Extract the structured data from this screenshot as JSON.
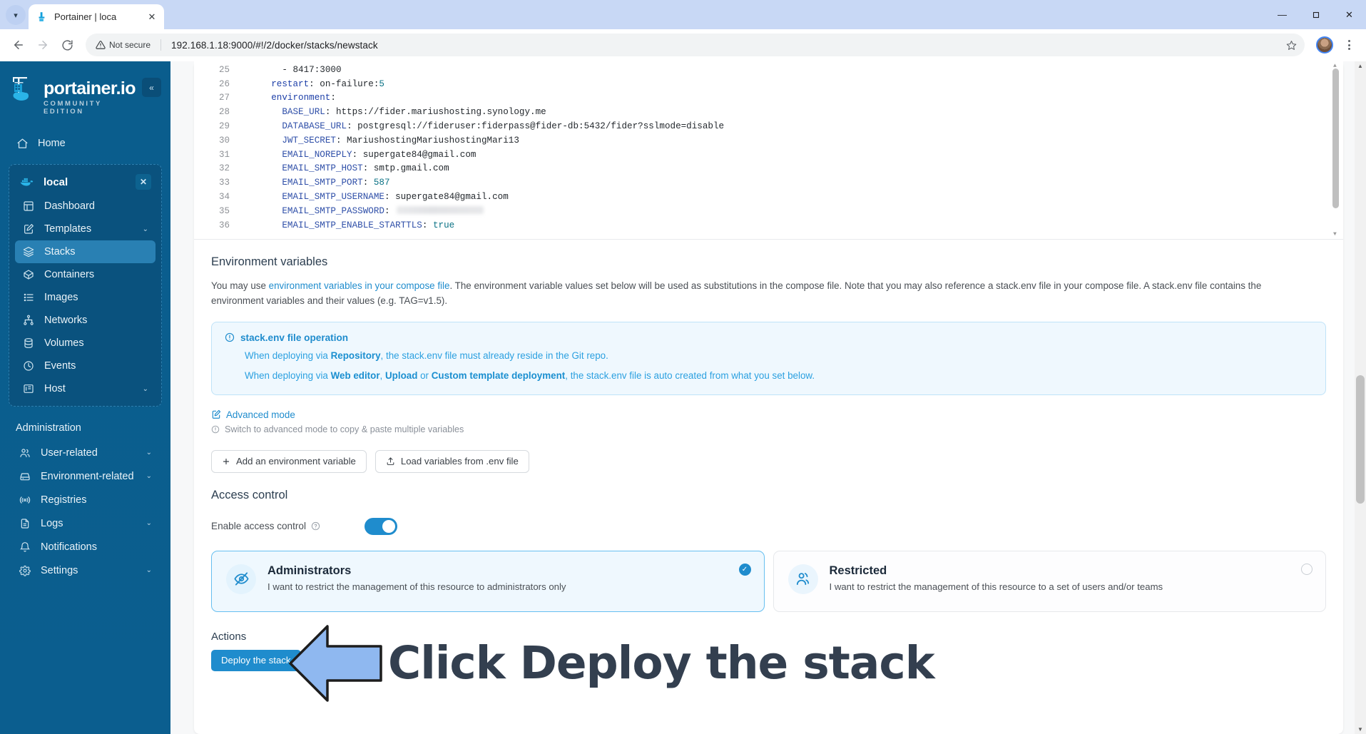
{
  "browser": {
    "tab": {
      "title": "Portainer | loca",
      "favicon_icon": "portainer-favicon",
      "close_icon": "close-icon"
    },
    "tab_list_icon": "chevron-down-icon",
    "window": {
      "minimize": "minimize-icon",
      "maximize": "maximize-icon",
      "close": "close-icon"
    },
    "nav": {
      "back": "back-arrow-icon",
      "forward": "forward-arrow-icon",
      "reload": "reload-icon"
    },
    "omnibox": {
      "security_label": "Not secure",
      "security_icon": "warning-triangle-icon",
      "url": "192.168.1.18:9000/#!/2/docker/stacks/newstack",
      "bookmark_icon": "star-icon"
    },
    "profile_icon": "avatar",
    "menu_icon": "kebab-menu-icon"
  },
  "sidebar": {
    "brand": {
      "name": "portainer.io",
      "edition": "COMMUNITY EDITION",
      "logo_icon": "portainer-logo-icon"
    },
    "collapse_icon": "double-chevron-left-icon",
    "home": {
      "label": "Home",
      "icon": "home-icon"
    },
    "environment": {
      "name": "local",
      "icon": "docker-whale-icon",
      "close_icon": "close-icon",
      "items": [
        {
          "label": "Dashboard",
          "icon": "dashboard-icon",
          "chevron": "",
          "active": false
        },
        {
          "label": "Templates",
          "icon": "template-edit-icon",
          "chevron": "chevron-down-icon",
          "active": false
        },
        {
          "label": "Stacks",
          "icon": "stacks-layers-icon",
          "chevron": "",
          "active": true
        },
        {
          "label": "Containers",
          "icon": "container-box-icon",
          "chevron": "",
          "active": false
        },
        {
          "label": "Images",
          "icon": "images-list-icon",
          "chevron": "",
          "active": false
        },
        {
          "label": "Networks",
          "icon": "network-nodes-icon",
          "chevron": "",
          "active": false
        },
        {
          "label": "Volumes",
          "icon": "volumes-database-icon",
          "chevron": "",
          "active": false
        },
        {
          "label": "Events",
          "icon": "clock-icon",
          "chevron": "",
          "active": false
        },
        {
          "label": "Host",
          "icon": "host-server-icon",
          "chevron": "chevron-down-icon",
          "active": false
        }
      ]
    },
    "administration_label": "Administration",
    "admin_items": [
      {
        "label": "User-related",
        "icon": "users-icon",
        "chevron": "chevron-down-icon"
      },
      {
        "label": "Environment-related",
        "icon": "environment-box-icon",
        "chevron": "chevron-down-icon"
      },
      {
        "label": "Registries",
        "icon": "registry-broadcast-icon",
        "chevron": ""
      },
      {
        "label": "Logs",
        "icon": "document-lines-icon",
        "chevron": "chevron-down-icon"
      },
      {
        "label": "Notifications",
        "icon": "bell-icon",
        "chevron": ""
      },
      {
        "label": "Settings",
        "icon": "gear-icon",
        "chevron": "chevron-down-icon"
      }
    ]
  },
  "editor": {
    "lines": [
      {
        "no": "25",
        "indent": 6,
        "segments": [
          {
            "t": "- ",
            "c": "k-str"
          },
          {
            "t": "8417:3000",
            "c": "k-str"
          }
        ]
      },
      {
        "no": "26",
        "indent": 4,
        "segments": [
          {
            "t": "restart",
            "c": "k-key"
          },
          {
            "t": ": on-failure:",
            "c": "k-str"
          },
          {
            "t": "5",
            "c": "k-num"
          }
        ]
      },
      {
        "no": "27",
        "indent": 4,
        "segments": [
          {
            "t": "environment",
            "c": "k-key"
          },
          {
            "t": ":",
            "c": "k-str"
          }
        ]
      },
      {
        "no": "28",
        "indent": 6,
        "segments": [
          {
            "t": "BASE_URL",
            "c": "k-prop"
          },
          {
            "t": ": https://fider.mariushosting.synology.me",
            "c": "k-str"
          }
        ]
      },
      {
        "no": "29",
        "indent": 6,
        "segments": [
          {
            "t": "DATABASE_URL",
            "c": "k-prop"
          },
          {
            "t": ": postgresql://fideruser:fiderpass@fider-db:5432/fider?sslmode=disable",
            "c": "k-str"
          }
        ]
      },
      {
        "no": "30",
        "indent": 6,
        "segments": [
          {
            "t": "JWT_SECRET",
            "c": "k-prop"
          },
          {
            "t": ": MariushostingMariushostingMari13",
            "c": "k-str"
          }
        ]
      },
      {
        "no": "31",
        "indent": 6,
        "segments": [
          {
            "t": "EMAIL_NOREPLY",
            "c": "k-prop"
          },
          {
            "t": ": supergate84@gmail.com",
            "c": "k-str"
          }
        ]
      },
      {
        "no": "32",
        "indent": 6,
        "segments": [
          {
            "t": "EMAIL_SMTP_HOST",
            "c": "k-prop"
          },
          {
            "t": ": smtp.gmail.com",
            "c": "k-str"
          }
        ]
      },
      {
        "no": "33",
        "indent": 6,
        "segments": [
          {
            "t": "EMAIL_SMTP_PORT",
            "c": "k-prop"
          },
          {
            "t": ": ",
            "c": "k-str"
          },
          {
            "t": "587",
            "c": "k-num"
          }
        ]
      },
      {
        "no": "34",
        "indent": 6,
        "segments": [
          {
            "t": "EMAIL_SMTP_USERNAME",
            "c": "k-prop"
          },
          {
            "t": ": supergate84@gmail.com",
            "c": "k-str"
          }
        ]
      },
      {
        "no": "35",
        "indent": 6,
        "segments": [
          {
            "t": "EMAIL_SMTP_PASSWORD",
            "c": "k-prop"
          },
          {
            "t": ": ",
            "c": "k-str"
          },
          {
            "t": "",
            "c": "redacted"
          }
        ]
      },
      {
        "no": "36",
        "indent": 6,
        "segments": [
          {
            "t": "EMAIL_SMTP_ENABLE_STARTTLS",
            "c": "k-prop"
          },
          {
            "t": ": ",
            "c": "k-str"
          },
          {
            "t": "true",
            "c": "k-bool"
          }
        ]
      }
    ]
  },
  "env_section": {
    "title": "Environment variables",
    "para_before_link": "You may use ",
    "link_text": "environment variables in your compose file",
    "para_after_link": ". The environment variable values set below will be used as substitutions in the compose file. Note that you may also reference a stack.env file in your compose file. A stack.env file contains the environment variables and their values (e.g. TAG=v1.5).",
    "info": {
      "icon": "info-circle-icon",
      "title": "stack.env file operation",
      "line1_a": "When deploying via ",
      "line1_b": "Repository",
      "line1_c": ", the stack.env file must already reside in the Git repo.",
      "line2_a": "When deploying via ",
      "line2_b": "Web editor",
      "line2_c": ", ",
      "line2_d": "Upload",
      "line2_e": " or ",
      "line2_f": "Custom template deployment",
      "line2_g": ", the stack.env file is auto created from what you set below."
    },
    "advanced_mode": {
      "label": "Advanced mode",
      "icon": "edit-square-icon"
    },
    "advanced_hint": {
      "text": "Switch to advanced mode to copy & paste multiple variables",
      "icon": "info-circle-icon"
    },
    "buttons": [
      {
        "label": "Add an environment variable",
        "icon": "plus-icon"
      },
      {
        "label": "Load variables from .env file",
        "icon": "upload-icon"
      }
    ]
  },
  "access_control": {
    "title": "Access control",
    "enable_label": "Enable access control",
    "help_icon": "question-circle-icon",
    "toggle_on": true,
    "options": [
      {
        "title": "Administrators",
        "desc": "I want to restrict the management of this resource to administrators only",
        "icon": "eye-slash-icon",
        "selected": true,
        "selected_icon": "check-circle-icon"
      },
      {
        "title": "Restricted",
        "desc": "I want to restrict the management of this resource to a set of users and/or teams",
        "icon": "users-group-icon",
        "selected": false,
        "radio_icon": "radio-empty-icon"
      }
    ]
  },
  "actions": {
    "title": "Actions",
    "deploy_label": "Deploy the stack",
    "annotation_text": "Click Deploy the stack",
    "annotation_arrow_icon": "left-arrow-annotation-icon"
  },
  "colors": {
    "brand_blue": "#1f8ccd",
    "sidebar_blue": "#0a5d8d",
    "sidebar_active": "#2980b3",
    "info_bg": "#eff8fe",
    "annotation_fill": "#8fb8f0",
    "annotation_text": "#333f4f"
  }
}
